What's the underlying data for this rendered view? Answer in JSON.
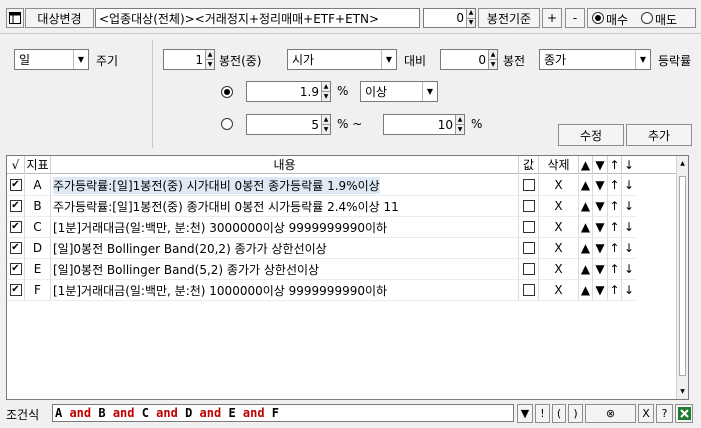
{
  "toolbar": {
    "change_btn": "대상변경",
    "target_field": "<업종대상(전체)><거래정지+정리매매+ETF+ETN>",
    "candle_value": "0",
    "candle_basis_btn": "봉전기준",
    "plus_btn": "+",
    "minus_btn": "-",
    "buy_label": "매수",
    "sell_label": "매도",
    "buy_selected": true
  },
  "settings": {
    "period_select": "일",
    "period_label": "주기",
    "offset_value": "1",
    "offset_label": "봉전(중)",
    "price_select": "시가",
    "compare_label": "대비",
    "compare_offset": "0",
    "compare_offset_label": "봉전",
    "compare_price_select": "종가",
    "rate_label": "등락률",
    "option1_selected": true,
    "rate_value": "1.9",
    "pct_unit1": "%",
    "condition_select": "이상",
    "range_from": "5",
    "pct_unit2": "% ~",
    "range_to": "10",
    "pct_unit3": "%",
    "modify_btn": "수정",
    "add_btn": "추가"
  },
  "table": {
    "headers": [
      "√",
      "지표",
      "내용",
      "값",
      "삭제",
      "▲",
      "▼",
      "↑",
      "↓"
    ],
    "rows": [
      {
        "id": "A",
        "text": "주가등락률:[일]1봉전(중) 시가대비 0봉전 종가등락률 1.9%이상",
        "del": "X",
        "checked": true
      },
      {
        "id": "B",
        "text": "주가등락률:[일]1봉전(중) 종가대비 0봉전 시가등락률 2.4%이상 11",
        "del": "X",
        "checked": true
      },
      {
        "id": "C",
        "text": "[1분]거래대금(일:백만, 분:천) 3000000이상 9999999990이하",
        "del": "X",
        "checked": true
      },
      {
        "id": "D",
        "text": "[일]0봉전 Bollinger Band(20,2) 종가가 상한선이상",
        "del": "X",
        "checked": true
      },
      {
        "id": "E",
        "text": "[일]0봉전 Bollinger Band(5,2) 종가가 상한선이상",
        "del": "X",
        "checked": true
      },
      {
        "id": "F",
        "text": "[1분]거래대금(일:백만, 분:천) 1000000이상 9999999990이하",
        "del": "X",
        "checked": true
      }
    ]
  },
  "bottom": {
    "label": "조건식",
    "expression": [
      {
        "t": "A",
        "op": false
      },
      {
        "t": " and ",
        "op": true
      },
      {
        "t": "B",
        "op": false
      },
      {
        "t": " and ",
        "op": true
      },
      {
        "t": "C",
        "op": false
      },
      {
        "t": " and ",
        "op": true
      },
      {
        "t": "D",
        "op": false
      },
      {
        "t": " and ",
        "op": true
      },
      {
        "t": "E",
        "op": false
      },
      {
        "t": " and ",
        "op": true
      },
      {
        "t": "F",
        "op": false
      }
    ],
    "buttons": [
      "▼",
      "!",
      "(",
      ")",
      "⊗",
      "X",
      "?"
    ]
  },
  "colors": {
    "and_color": "#c00000",
    "excel_green": "#1e7a33"
  }
}
